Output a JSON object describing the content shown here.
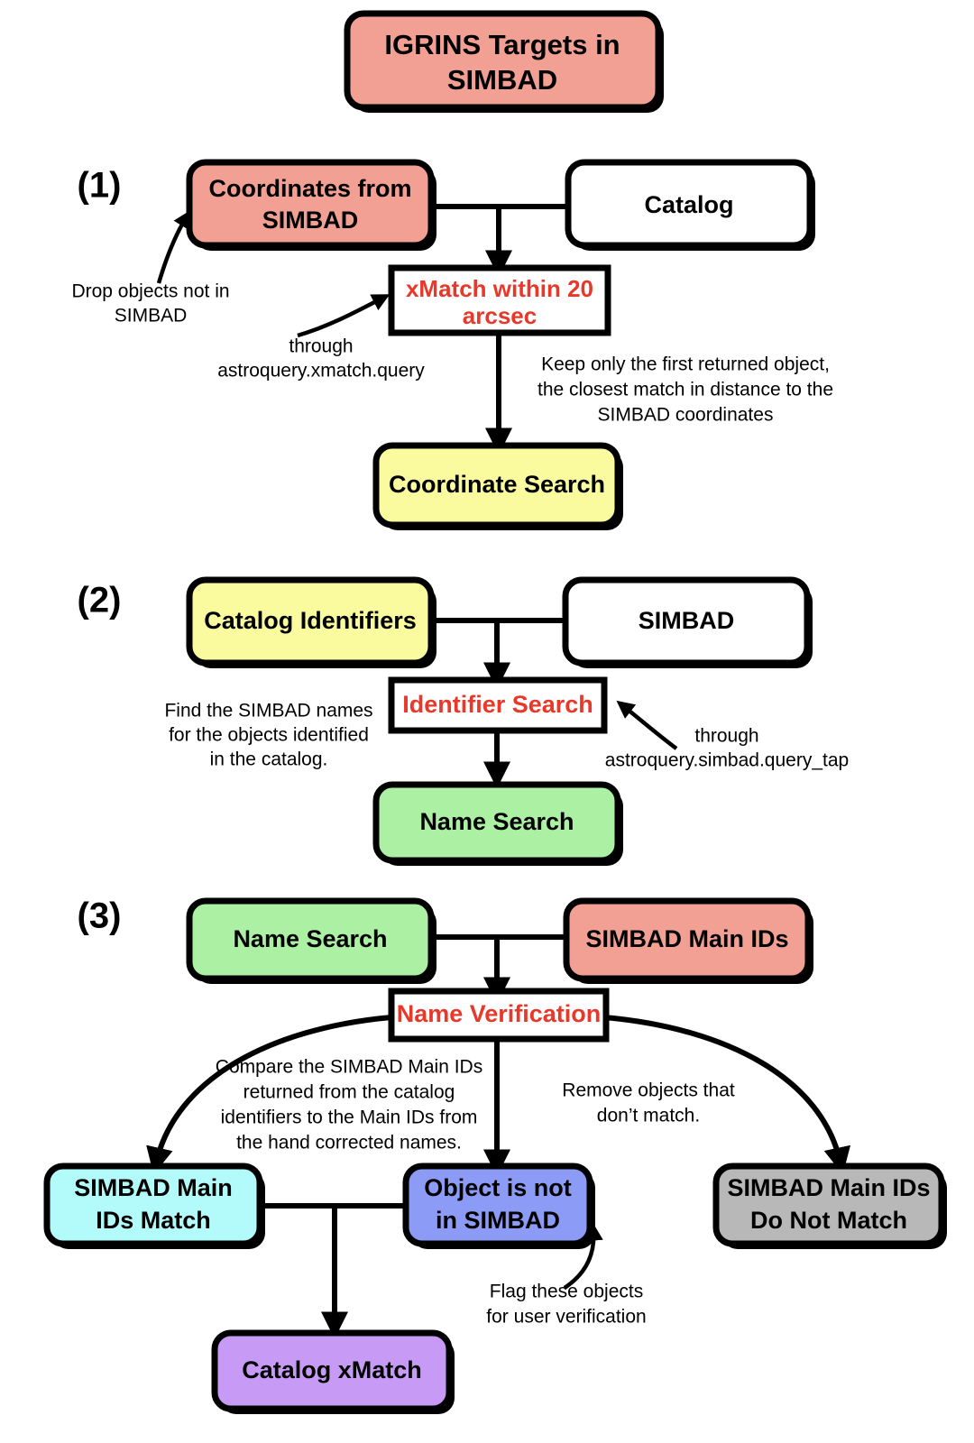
{
  "title": {
    "text_line1": "IGRINS Targets in",
    "text_line2": "SIMBAD"
  },
  "colors": {
    "salmon": "#f2a093",
    "yellow": "#fafa9e",
    "green": "#acf0a4",
    "cyan": "#b3fafa",
    "blue": "#8c9bf5",
    "purple": "#c79af5",
    "gray": "#b8b8b8",
    "white": "#ffffff",
    "red_text": "#e8382a",
    "black": "#000000"
  },
  "steps": {
    "one": "(1)",
    "two": "(2)",
    "three": "(3)"
  },
  "section1": {
    "coordinates_box_line1": "Coordinates from",
    "coordinates_box_line2": "SIMBAD",
    "catalog_box": "Catalog",
    "xmatch_box_line1": "xMatch within 20",
    "xmatch_box_line2": "arcsec",
    "coordinate_search_box": "Coordinate Search",
    "annot_drop_line1": "Drop objects not in",
    "annot_drop_line2": "SIMBAD",
    "annot_through_line1": "through",
    "annot_through_line2": "astroquery.xmatch.query",
    "annot_keep_line1": "Keep only the first returned object,",
    "annot_keep_line2": "the closest match in distance to the",
    "annot_keep_line3": "SIMBAD coordinates"
  },
  "section2": {
    "catalog_identifiers_box": "Catalog Identifiers",
    "simbad_box": "SIMBAD",
    "identifier_search_box": "Identifier Search",
    "name_search_box": "Name Search",
    "annot_find_line1": "Find the SIMBAD names",
    "annot_find_line2": "for the objects identified",
    "annot_find_line3": "in the catalog.",
    "annot_through_line1": "through",
    "annot_through_line2": "astroquery.simbad.query_tap"
  },
  "section3": {
    "name_search_box": "Name Search",
    "simbad_main_ids_box": "SIMBAD Main IDs",
    "name_verification_box": "Name Verification",
    "match_box_line1": "SIMBAD Main",
    "match_box_line2": "IDs Match",
    "not_in_simbad_box_line1": "Object is not",
    "not_in_simbad_box_line2": "in SIMBAD",
    "no_match_box_line1": "SIMBAD Main IDs",
    "no_match_box_line2": "Do Not Match",
    "catalog_xmatch_box": "Catalog xMatch",
    "annot_compare_line1": "Compare the SIMBAD Main IDs",
    "annot_compare_line2": "returned from the catalog",
    "annot_compare_line3": "identifiers to the Main IDs from",
    "annot_compare_line4": "the hand corrected names.",
    "annot_remove_line1": "Remove objects that",
    "annot_remove_line2": "don’t match.",
    "annot_flag_line1": "Flag these objects",
    "annot_flag_line2": "for user verification"
  }
}
